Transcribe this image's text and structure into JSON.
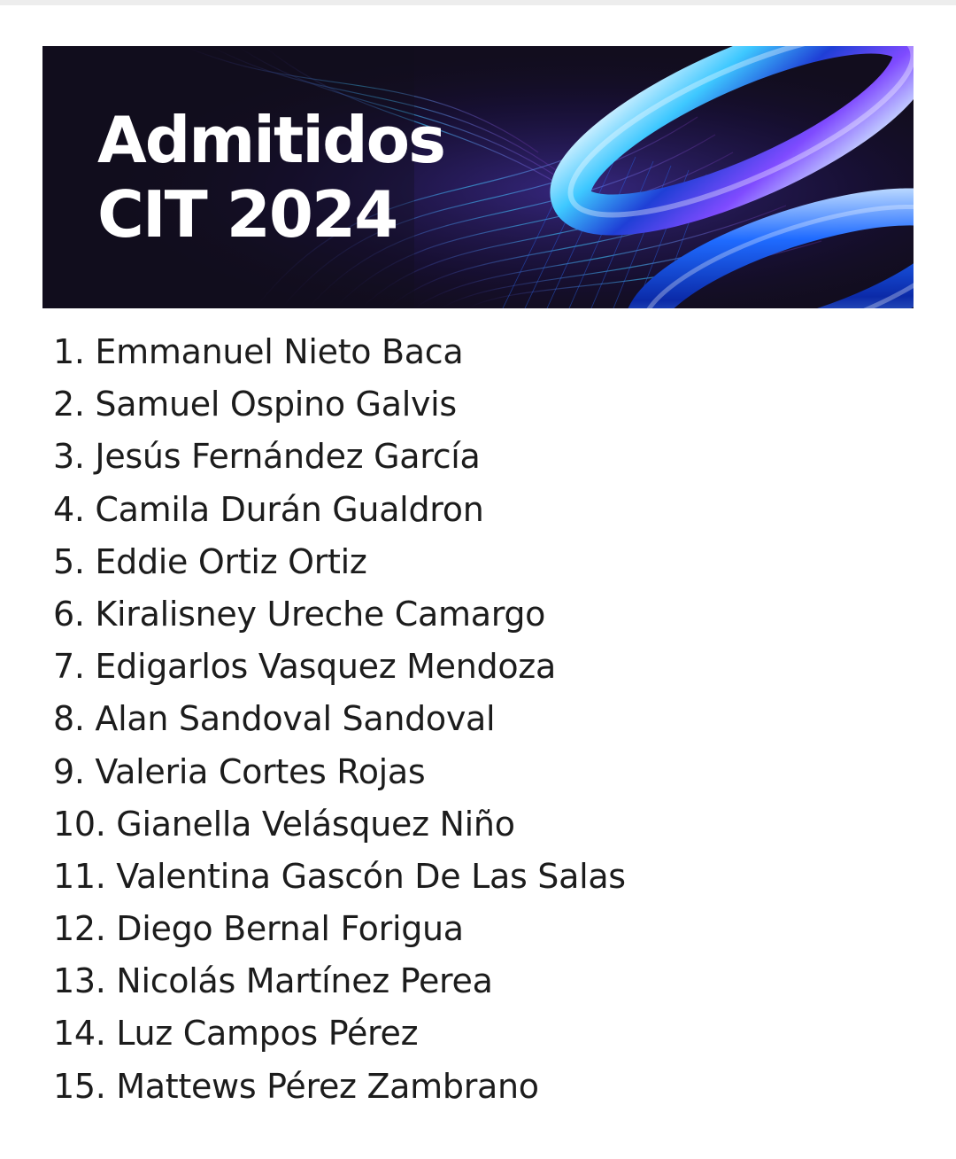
{
  "banner": {
    "title_line1": "Admitidos",
    "title_line2": "CIT 2024"
  },
  "colors": {
    "banner_background": "#120d1e",
    "accent_blue": "#1f6bff",
    "accent_cyan": "#3ec8ff",
    "text": "#1c1c1c"
  },
  "admitted": [
    "1. Emmanuel Nieto Baca",
    "2. Samuel Ospino Galvis",
    "3. Jesús Fernández García",
    "4. Camila Durán Gualdron",
    "5. Eddie Ortiz Ortiz",
    "6. Kiralisney Ureche Camargo",
    "7. Edigarlos Vasquez Mendoza",
    "8. Alan Sandoval Sandoval",
    "9. Valeria Cortes Rojas",
    "10. Gianella Velásquez Niño",
    "11. Valentina Gascón De Las Salas",
    "12. Diego Bernal Forigua",
    "13. Nicolás Martínez Perea",
    "14. Luz Campos Pérez",
    "15. Mattews Pérez Zambrano"
  ]
}
